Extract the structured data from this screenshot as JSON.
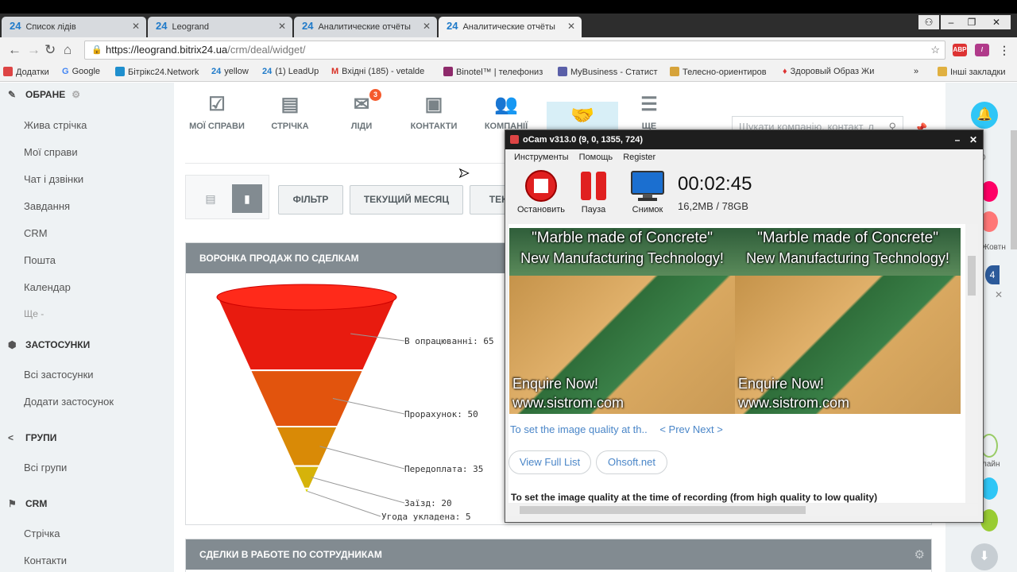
{
  "tabs": [
    {
      "label": "Список лідів",
      "active": false
    },
    {
      "label": "Leogrand",
      "active": false
    },
    {
      "label": "Аналитические отчёты",
      "active": false
    },
    {
      "label": "Аналитические отчёты",
      "active": true
    }
  ],
  "address": {
    "host": "https://leogrand.bitrix24.ua",
    "path": "/crm/deal/widget/"
  },
  "bookmarks": [
    {
      "label": "Додатки",
      "color": "#d44"
    },
    {
      "label": "Google",
      "color": "#4285f4"
    },
    {
      "label": "Бітрікс24.Network",
      "color": "#1f8fce"
    },
    {
      "label": "yellow",
      "color": "#1f7ac9"
    },
    {
      "label": "(1) LeadUp",
      "color": "#1f7ac9"
    },
    {
      "label": "Вхідні (185) - vetalde",
      "color": "#d93025"
    },
    {
      "label": "Binotel™ | телефониз",
      "color": "#8e2a6b"
    },
    {
      "label": "MyBusiness - Статист",
      "color": "#5a5fa8"
    },
    {
      "label": "Телесно-ориентиров",
      "color": "#d6a33a"
    },
    {
      "label": "Здоровый Образ Жи",
      "color": "#d33"
    },
    {
      "label": "Інші закладки",
      "color": "#e0b040"
    }
  ],
  "sidebar": {
    "favorites": "ОБРАНЕ",
    "fav_items": [
      "Жива стрічка",
      "Мої справи",
      "Чат і дзвінки",
      "Завдання",
      "CRM",
      "Пошта",
      "Календар",
      "Ще -"
    ],
    "apps": "ЗАСТОСУНКИ",
    "app_items": [
      "Всі застосунки",
      "Додати застосунок"
    ],
    "groups": "ГРУПИ",
    "group_items": [
      "Всі групи"
    ],
    "crm": "CRM",
    "crm_items": [
      "Стрічка",
      "Контакти"
    ]
  },
  "topnav": [
    {
      "label": "МОЇ СПРАВИ",
      "icon": "checklist-icon"
    },
    {
      "label": "СТРІЧКА",
      "icon": "document-icon"
    },
    {
      "label": "ЛІДИ",
      "icon": "leads-icon",
      "badge": "3"
    },
    {
      "label": "КОНТАКТИ",
      "icon": "contact-card-icon"
    },
    {
      "label": "КОМПАНІЇ",
      "icon": "users-icon"
    },
    {
      "label": "УГОДИ",
      "icon": "handshake-icon"
    },
    {
      "label": "ЩЕ",
      "icon": "list-icon"
    }
  ],
  "search_placeholder": "Шукати компанію, контакт, л",
  "filters": {
    "filter": "ФІЛЬТР",
    "current_month": "ТЕКУЩИЙ МЕСЯЦ",
    "third": "ТЕКУ"
  },
  "widget1": {
    "title": "ВОРОНКА ПРОДАЖ ПО СДЕЛКАМ"
  },
  "widget2": {
    "title": "СДЕЛКИ В РАБОТЕ ПО СОТРУДНИКАМ"
  },
  "chart_data": {
    "type": "funnel",
    "categories": [
      "В опрацюванні",
      "Прорахунок",
      "Передоплата",
      "Заїзд",
      "Угода укладена"
    ],
    "values": [
      65,
      50,
      35,
      20,
      5
    ],
    "labels": [
      "В опрацюванні: 65",
      "Прорахунок: 50",
      "Передоплата: 35",
      "Заїзд: 20",
      "Угода укладена: 5"
    ],
    "colors": [
      "#e81b0f",
      "#e2540d",
      "#d98a06",
      "#d6b30a",
      "#d8d40a"
    ]
  },
  "ocam": {
    "title": "oCam v313.0 (9, 0, 1355, 724)",
    "menu": [
      "Инструменты",
      "Помощь",
      "Register"
    ],
    "buttons": [
      "Остановить",
      "Пауза",
      "Снимок"
    ],
    "timer": "00:02:45",
    "size": "16,2MB / 78GB",
    "ad_title1": "\"Marble made of Concrete\"",
    "ad_title2": "New Manufacturing Technology!",
    "ad_cta": "Enquire Now!",
    "ad_url": "www.sistrom.com",
    "link_text": "To set the image quality at th..",
    "prev_next": "< Prev Next >",
    "btn_full": "View Full List",
    "btn_ohsoft": "Ohsoft.net",
    "body": "To set the image quality at the time of recording (from high quality to low quality)"
  },
  "right_sidebar": {
    "chat_label": "Жовтн",
    "online": "лайн",
    "counter": "4"
  }
}
